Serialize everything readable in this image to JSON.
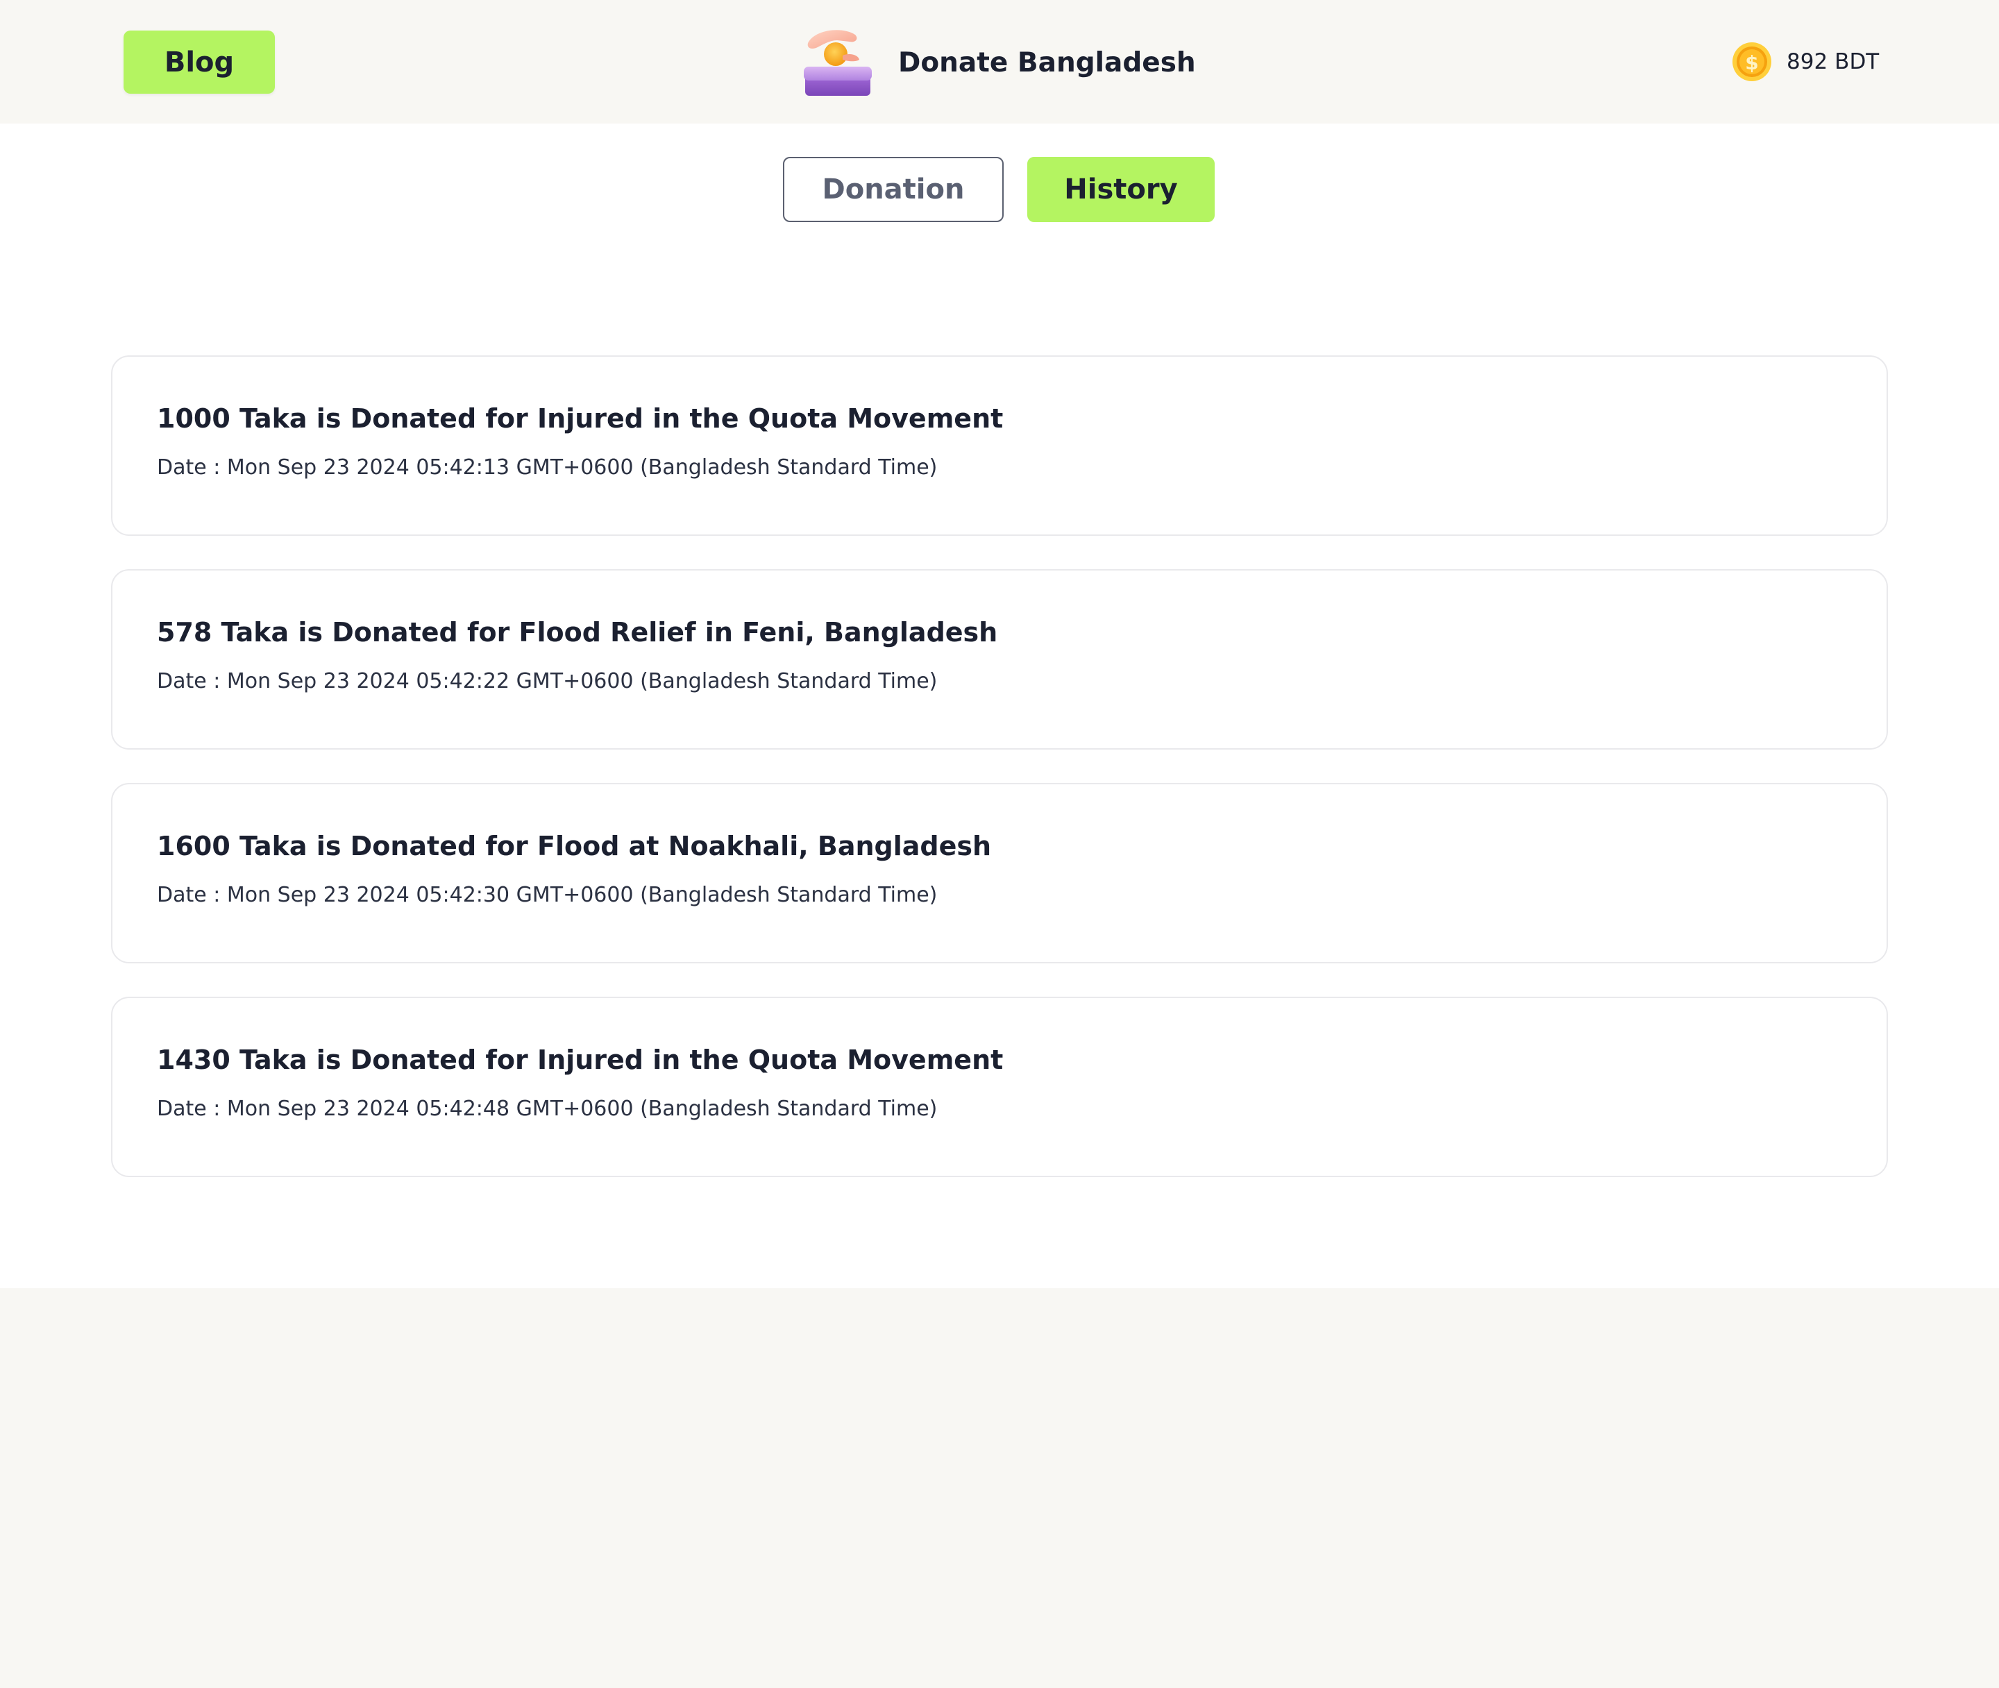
{
  "header": {
    "blog_label": "Blog",
    "brand_title": "Donate Bangladesh",
    "brand_logo_icon": "donation-hand-coin-icon",
    "balance_icon": "coin-icon",
    "balance_amount": "892",
    "balance_unit": "BDT"
  },
  "tabs": [
    {
      "label": "Donation",
      "active": false
    },
    {
      "label": "History",
      "active": true
    }
  ],
  "colors": {
    "accent": "#b4f461",
    "header_bg": "#f8f7f3",
    "text_primary": "#1b2030",
    "card_border": "#e9e9ec"
  },
  "history": [
    {
      "title": "1000 Taka is Donated for Injured in the Quota Movement",
      "date": "Date : Mon Sep 23 2024 05:42:13 GMT+0600 (Bangladesh Standard Time)"
    },
    {
      "title": "578 Taka is Donated for Flood Relief in Feni, Bangladesh",
      "date": "Date : Mon Sep 23 2024 05:42:22 GMT+0600 (Bangladesh Standard Time)"
    },
    {
      "title": "1600 Taka is Donated for Flood at Noakhali, Bangladesh",
      "date": "Date : Mon Sep 23 2024 05:42:30 GMT+0600 (Bangladesh Standard Time)"
    },
    {
      "title": "1430 Taka is Donated for Injured in the Quota Movement",
      "date": "Date : Mon Sep 23 2024 05:42:48 GMT+0600 (Bangladesh Standard Time)"
    }
  ]
}
